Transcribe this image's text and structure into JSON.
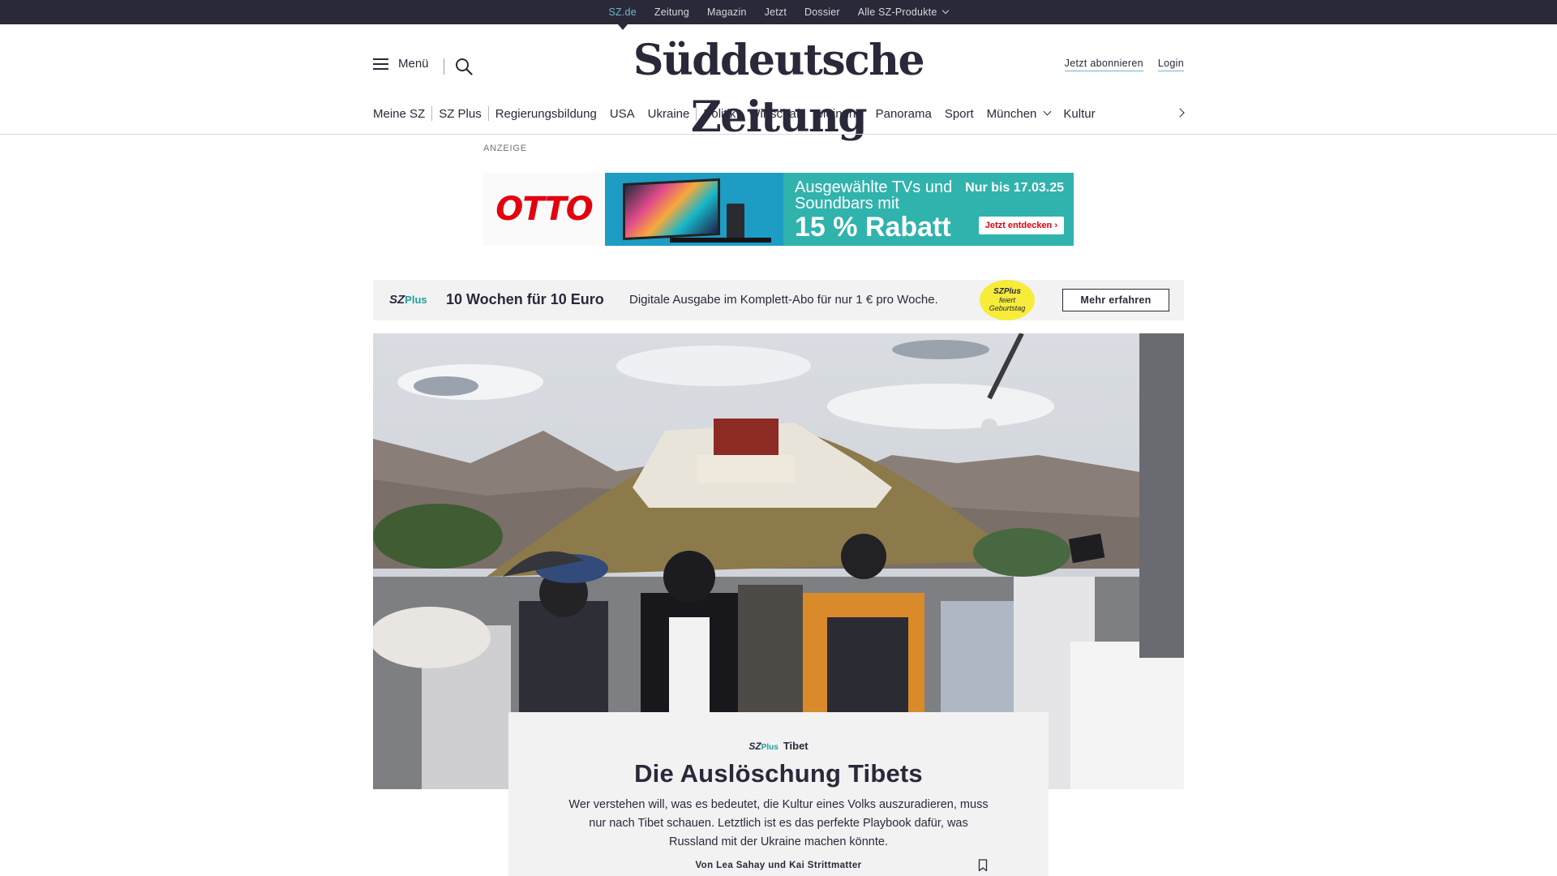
{
  "topbar": {
    "links": [
      "SZ.de",
      "Zeitung",
      "Magazin",
      "Jetzt",
      "Dossier",
      "Alle SZ-Produkte"
    ]
  },
  "header": {
    "menu_label": "Menü",
    "logo_text": "Süddeutsche Zeitung",
    "subscribe_label": "Jetzt abonnieren",
    "login_label": "Login"
  },
  "nav": {
    "items": [
      "Meine SZ",
      "SZ Plus",
      "Regierungsbildung",
      "USA",
      "Ukraine",
      "Politik",
      "Wirtschaft",
      "Meinung",
      "Panorama",
      "Sport",
      "München",
      "Kultur"
    ]
  },
  "ad": {
    "label": "ANZEIGE",
    "brand": "OTTO",
    "line1": "Ausgewählte TVs und Soundbars mit",
    "headline": "15 % Rabatt",
    "date": "Nur bis 17.03.25",
    "cta": "Jetzt entdecken ›"
  },
  "promo": {
    "logo_sz": "SZ",
    "logo_plus": "Plus",
    "title": "10 Wochen für 10 Euro",
    "description": "Digitale Ausgabe im Komplett-Abo für nur 1 € pro Woche.",
    "badge_line1": "SZPlus",
    "badge_line2": "feiert",
    "badge_line3": "Geburtstag",
    "button": "Mehr erfahren"
  },
  "teaser": {
    "kicker_sz": "SZ",
    "kicker_plus": "Plus",
    "kicker": "Tibet",
    "title": "Die Auslöschung Tibets",
    "text": "Wer verstehen will, was es bedeutet, die Kultur eines Volks auszuradieren, muss nur nach Tibet schauen. Letztlich ist es das perfekte Playbook dafür, was Russland mit der Ukraine machen könnte.",
    "author": "Von Lea Sahay und Kai Strittmatter"
  },
  "colors": {
    "dark": "#29293a",
    "accent_teal": "#71b5c9",
    "sz_plus_green": "#1ea0a0",
    "otto_red": "#e3000f",
    "ad_teal": "#30b3ad",
    "badge_yellow": "#f7ec3a"
  }
}
